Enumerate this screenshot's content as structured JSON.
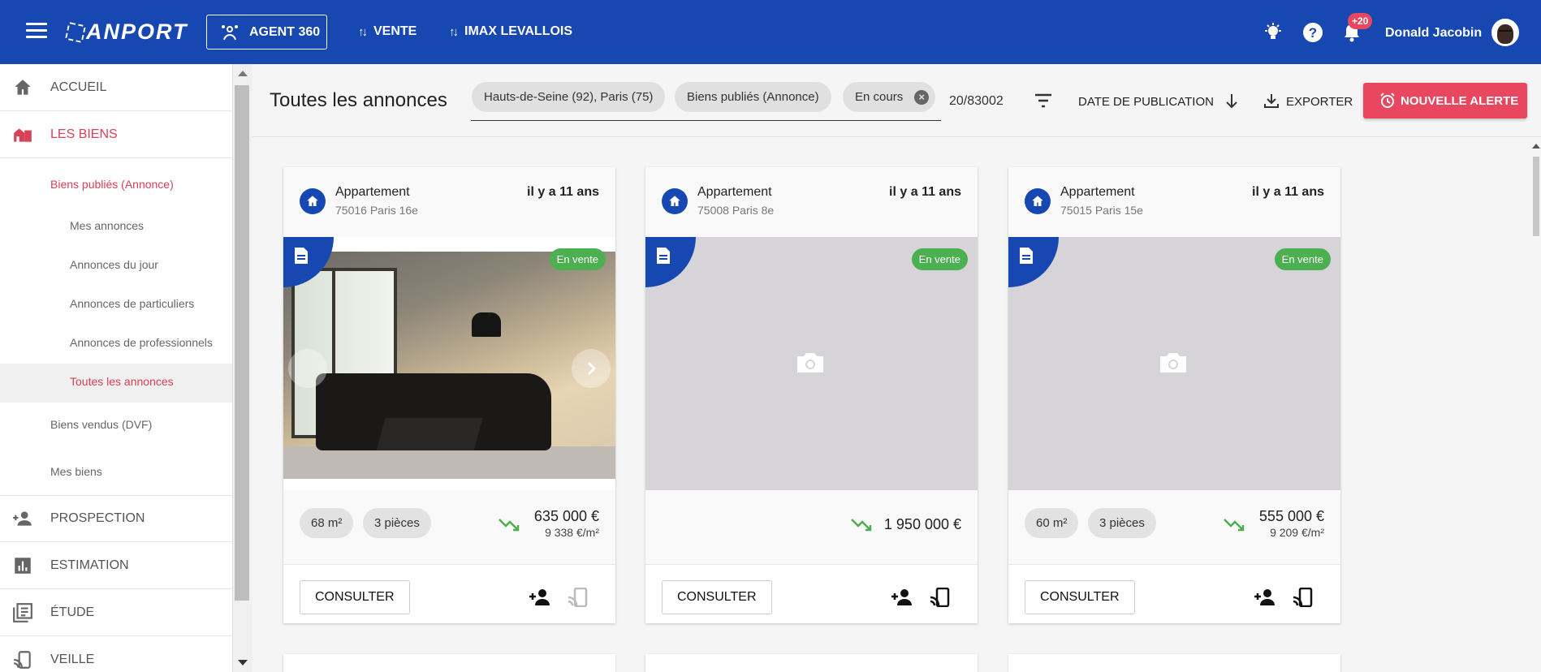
{
  "topbar": {
    "logo": "ANPORT",
    "agent_label": "AGENT 360",
    "nav": [
      {
        "label": "VENTE"
      },
      {
        "label": "IMAX LEVALLOIS"
      }
    ],
    "notifications_badge": "+20",
    "username": "Donald Jacobin",
    "icons": [
      "menu-icon",
      "agent-icon",
      "lightbulb-icon",
      "help-icon",
      "bell-icon"
    ]
  },
  "sidebar": {
    "main_items": [
      {
        "label": "ACCUEIL",
        "icon": "home-icon"
      },
      {
        "label": "LES BIENS",
        "icon": "buildings-icon",
        "active": true
      },
      {
        "label": "PROSPECTION",
        "icon": "person-add-icon"
      },
      {
        "label": "ESTIMATION",
        "icon": "bar-chart-icon"
      },
      {
        "label": "ÉTUDE",
        "icon": "library-icon"
      },
      {
        "label": "VEILLE",
        "icon": "cast-icon"
      }
    ],
    "sub_items": [
      {
        "label": "Biens publiés (Annonce)"
      },
      {
        "label": "Biens vendus (DVF)"
      },
      {
        "label": "Mes biens"
      }
    ],
    "subsub_items": [
      {
        "label": "Mes annonces"
      },
      {
        "label": "Annonces du jour"
      },
      {
        "label": "Annonces de particuliers"
      },
      {
        "label": "Annonces de professionnels"
      },
      {
        "label": "Toutes les annonces"
      }
    ]
  },
  "header": {
    "title": "Toutes les annonces",
    "chips": [
      {
        "label": "Hauts-de-Seine (92), Paris (75)"
      },
      {
        "label": "Biens publiés (Annonce)"
      },
      {
        "label": "En cours"
      }
    ],
    "count": "20/83002",
    "sort_label": "DATE DE PUBLICATION",
    "export_label": "EXPORTER",
    "alert_label": "NOUVELLE ALERTE"
  },
  "cards": [
    {
      "type": "Appartement",
      "location": "75016 Paris 16e",
      "age": "il y a 11 ans",
      "status": "En vente",
      "surface": "68 m²",
      "rooms": "3 pièces",
      "price": "635 000 €",
      "price_per_m2": "9 338 €/m²",
      "consult_label": "CONSULTER"
    },
    {
      "type": "Appartement",
      "location": "75008 Paris 8e",
      "age": "il y a 11 ans",
      "status": "En vente",
      "price": "1 950 000 €",
      "consult_label": "CONSULTER"
    },
    {
      "type": "Appartement",
      "location": "75015 Paris 15e",
      "age": "il y a 11 ans",
      "status": "En vente",
      "surface": "60 m²",
      "rooms": "3 pièces",
      "price": "555 000 €",
      "price_per_m2": "9 209 €/m²",
      "consult_label": "CONSULTER"
    }
  ],
  "colors": {
    "primary": "#1747b0",
    "accent": "#e8475f",
    "success": "#4caf50",
    "active_text": "#d94157"
  }
}
